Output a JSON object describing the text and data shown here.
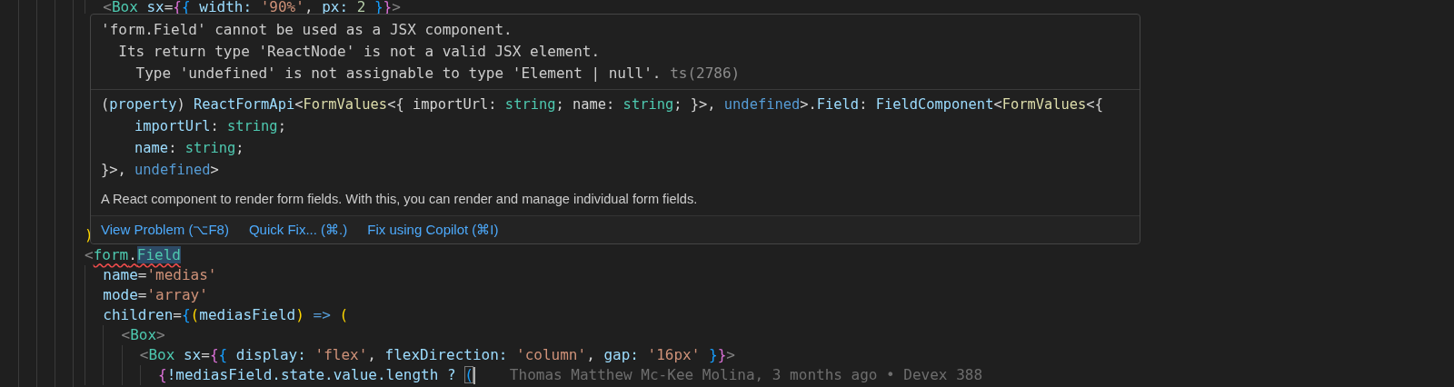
{
  "editor": {
    "lines": [
      {
        "tokens": [
          {
            "text": "  <",
            "kind": "punct"
          },
          {
            "text": "Box",
            "kind": "tag"
          },
          {
            "text": " sx",
            "kind": "attr"
          },
          {
            "text": "=",
            "kind": "plain"
          },
          {
            "text": "{",
            "kind": "bracket2"
          },
          {
            "text": "{",
            "kind": "bracket3"
          },
          {
            "text": " width: ",
            "kind": "attr"
          },
          {
            "text": "'90%'",
            "kind": "string"
          },
          {
            "text": ", ",
            "kind": "plain"
          },
          {
            "text": "px: ",
            "kind": "attr"
          },
          {
            "text": "2",
            "kind": "number"
          },
          {
            "text": " }",
            "kind": "bracket3"
          },
          {
            "text": "}",
            "kind": "bracket2"
          },
          {
            "text": ">",
            "kind": "punct"
          }
        ]
      },
      {
        "tokens": [
          {
            "text": ")",
            "kind": "bracket1"
          }
        ]
      },
      {
        "tokens": [
          {
            "text": "<",
            "kind": "punct"
          },
          {
            "text": "form",
            "kind": "tag",
            "error": true
          },
          {
            "text": ".",
            "kind": "plain",
            "error": true
          },
          {
            "text": "Field",
            "kind": "tag",
            "error": true,
            "highlighted": true
          }
        ]
      },
      {
        "tokens": [
          {
            "text": "  name",
            "kind": "attr"
          },
          {
            "text": "=",
            "kind": "plain"
          },
          {
            "text": "'medias'",
            "kind": "string"
          }
        ]
      },
      {
        "tokens": [
          {
            "text": "  mode",
            "kind": "attr"
          },
          {
            "text": "=",
            "kind": "plain"
          },
          {
            "text": "'array'",
            "kind": "string"
          }
        ]
      },
      {
        "tokens": [
          {
            "text": "  children",
            "kind": "attr"
          },
          {
            "text": "=",
            "kind": "plain"
          },
          {
            "text": "{",
            "kind": "bracket3"
          },
          {
            "text": "(",
            "kind": "bracket1"
          },
          {
            "text": "mediasField",
            "kind": "attr"
          },
          {
            "text": ")",
            "kind": "bracket1"
          },
          {
            "text": " =>",
            "kind": "keyword"
          },
          {
            "text": " (",
            "kind": "bracket1"
          }
        ]
      },
      {
        "tokens": [
          {
            "text": "    <",
            "kind": "punct"
          },
          {
            "text": "Box",
            "kind": "tag"
          },
          {
            "text": ">",
            "kind": "punct"
          }
        ]
      },
      {
        "tokens": [
          {
            "text": "      <",
            "kind": "punct"
          },
          {
            "text": "Box",
            "kind": "tag"
          },
          {
            "text": " sx",
            "kind": "attr"
          },
          {
            "text": "=",
            "kind": "plain"
          },
          {
            "text": "{",
            "kind": "bracket2"
          },
          {
            "text": "{",
            "kind": "bracket3"
          },
          {
            "text": " display: ",
            "kind": "attr"
          },
          {
            "text": "'flex'",
            "kind": "string"
          },
          {
            "text": ", ",
            "kind": "plain"
          },
          {
            "text": "flexDirection: ",
            "kind": "attr"
          },
          {
            "text": "'column'",
            "kind": "string"
          },
          {
            "text": ", ",
            "kind": "plain"
          },
          {
            "text": "gap: ",
            "kind": "attr"
          },
          {
            "text": "'16px'",
            "kind": "string"
          },
          {
            "text": " }",
            "kind": "bracket3"
          },
          {
            "text": "}",
            "kind": "bracket2"
          },
          {
            "text": ">",
            "kind": "punct"
          }
        ]
      },
      {
        "tokens": [
          {
            "text": "        {",
            "kind": "bracket2"
          },
          {
            "text": "!mediasField.state.value.length ? ",
            "kind": "attr"
          },
          {
            "text": "(",
            "kind": "bracket3",
            "matched": true,
            "caret": true
          }
        ],
        "blame": "Thomas Matthew Mc-Kee Molina, 3 months ago • Devex 388"
      }
    ]
  },
  "hover": {
    "error": {
      "lines": [
        "'form.Field' cannot be used as a JSX component.",
        "  Its return type 'ReactNode' is not a valid JSX element.",
        "    Type 'undefined' is not assignable to type 'Element | null'."
      ],
      "code": "ts(2786)"
    },
    "signature": [
      [
        {
          "text": "(",
          "kind": "plain"
        },
        {
          "text": "property",
          "kind": "attr"
        },
        {
          "text": ") ",
          "kind": "plain"
        },
        {
          "text": "ReactFormApi",
          "kind": "attr"
        },
        {
          "text": "<",
          "kind": "plain"
        },
        {
          "text": "FormValues",
          "kind": "func"
        },
        {
          "text": "<{ importUrl: ",
          "kind": "plain"
        },
        {
          "text": "string",
          "kind": "type"
        },
        {
          "text": "; name: ",
          "kind": "plain"
        },
        {
          "text": "string",
          "kind": "type"
        },
        {
          "text": "; }>, ",
          "kind": "plain"
        },
        {
          "text": "undefined",
          "kind": "keyword"
        },
        {
          "text": ">.",
          "kind": "plain"
        },
        {
          "text": "Field",
          "kind": "attr"
        },
        {
          "text": ": ",
          "kind": "plain"
        },
        {
          "text": "FieldComponent",
          "kind": "attr"
        },
        {
          "text": "<",
          "kind": "plain"
        },
        {
          "text": "FormValues",
          "kind": "func"
        },
        {
          "text": "<{",
          "kind": "plain"
        }
      ],
      [
        {
          "text": "    importUrl",
          "kind": "attr"
        },
        {
          "text": ": ",
          "kind": "plain"
        },
        {
          "text": "string",
          "kind": "type"
        },
        {
          "text": ";",
          "kind": "plain"
        }
      ],
      [
        {
          "text": "    name",
          "kind": "attr"
        },
        {
          "text": ": ",
          "kind": "plain"
        },
        {
          "text": "string",
          "kind": "type"
        },
        {
          "text": ";",
          "kind": "plain"
        }
      ],
      [
        {
          "text": "}>, ",
          "kind": "plain"
        },
        {
          "text": "undefined",
          "kind": "keyword"
        },
        {
          "text": ">",
          "kind": "plain"
        }
      ]
    ],
    "description": "A React component to render form fields. With this, you can render and manage individual form fields.",
    "actions": [
      "View Problem (⌥F8)",
      "Quick Fix... (⌘.)",
      "Fix using Copilot (⌘I)"
    ]
  }
}
